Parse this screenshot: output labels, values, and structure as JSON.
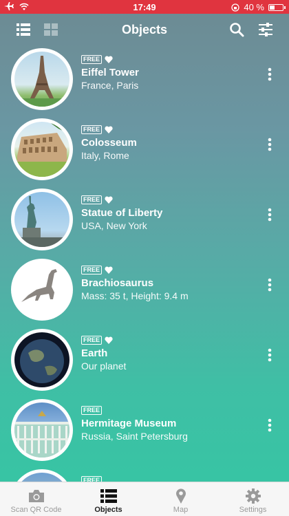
{
  "status_bar": {
    "carrier_icon": "airplane-icon",
    "time": "17:49",
    "battery": "40 %"
  },
  "nav": {
    "title": "Objects"
  },
  "objects": [
    {
      "badge": "FREE",
      "favorite": true,
      "name": "Eiffel Tower",
      "subtitle": "France, Paris"
    },
    {
      "badge": "FREE",
      "favorite": true,
      "name": "Colosseum",
      "subtitle": "Italy, Rome"
    },
    {
      "badge": "FREE",
      "favorite": true,
      "name": "Statue of Liberty",
      "subtitle": "USA, New York"
    },
    {
      "badge": "FREE",
      "favorite": true,
      "name": "Brachiosaurus",
      "subtitle": "Mass: 35 t, Height: 9.4 m"
    },
    {
      "badge": "FREE",
      "favorite": true,
      "name": "Earth",
      "subtitle": "Our planet"
    },
    {
      "badge": "FREE",
      "favorite": false,
      "name": "Hermitage Museum",
      "subtitle": "Russia, Saint Petersburg"
    },
    {
      "badge": "FREE",
      "favorite": false,
      "name": "",
      "subtitle": ""
    }
  ],
  "tabbar": {
    "tabs": [
      {
        "label": "Scan QR Code",
        "icon": "camera-icon"
      },
      {
        "label": "Objects",
        "icon": "list-icon"
      },
      {
        "label": "Map",
        "icon": "map-pin-icon"
      },
      {
        "label": "Settings",
        "icon": "gear-icon"
      }
    ],
    "active": "Objects"
  }
}
